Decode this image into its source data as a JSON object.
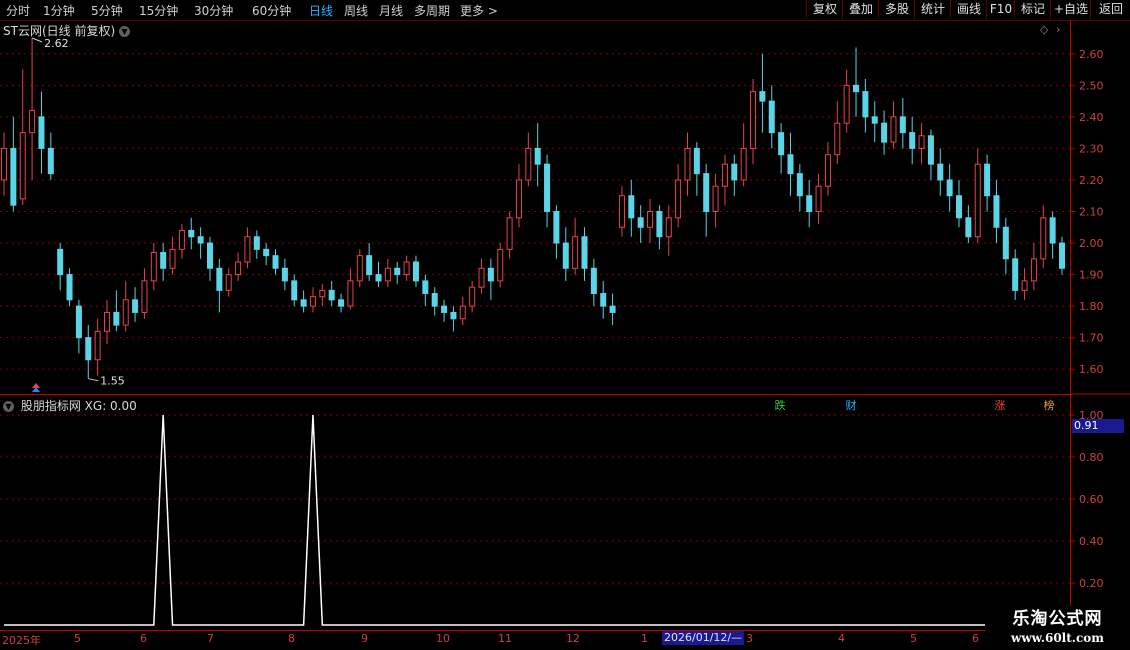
{
  "toolbar": {
    "periods": [
      "分时",
      "1分钟",
      "5分钟",
      "15分钟",
      "30分钟",
      "60分钟",
      "日线",
      "周线",
      "月线",
      "多周期",
      "更多 >"
    ],
    "active_period": "日线",
    "buttons": [
      "复权",
      "叠加",
      "多股",
      "统计",
      "画线",
      "F10",
      "标记",
      "+自选",
      "返回"
    ]
  },
  "main": {
    "title": "ST云网(日线 前复权)",
    "high_label": "2.62",
    "low_label": "1.55",
    "price_ticks": [
      "2.60",
      "2.50",
      "2.40",
      "2.30",
      "2.20",
      "2.10",
      "2.00",
      "1.90",
      "1.80",
      "1.70",
      "1.60"
    ],
    "badges": [
      {
        "text": "跌",
        "color": "#2ecc40"
      },
      {
        "text": "财",
        "color": "#2fb3ff"
      },
      {
        "text": "涨",
        "color": "#ff4040"
      },
      {
        "text": "榜",
        "color": "#e0a030"
      }
    ]
  },
  "indicator": {
    "title": "股朋指标网",
    "value_text": "XG: 0.00",
    "ticks": [
      "1.00",
      "0.80",
      "0.60",
      "0.40",
      "0.20"
    ],
    "cursor_value": "0.91"
  },
  "xaxis": {
    "months": [
      "2025年",
      "5",
      "6",
      "7",
      "8",
      "9",
      "10",
      "11",
      "12",
      "1",
      "2",
      "3",
      "4",
      "5",
      "6"
    ],
    "cursor_date": "2026/01/12/—"
  },
  "watermark": {
    "title": "乐淘公式网",
    "url": "www.60lt.com"
  },
  "colors": {
    "up": "#e8424c",
    "down": "#5ad4e6",
    "grid": "#8a0000",
    "signal": "#ffffff"
  },
  "chart_data": {
    "type": "candlestick",
    "ylim": [
      1.55,
      2.65
    ],
    "candles": [
      [
        2.2,
        2.3,
        2.15,
        2.35
      ],
      [
        2.3,
        2.12,
        2.1,
        2.4
      ],
      [
        2.14,
        2.35,
        2.12,
        2.55
      ],
      [
        2.35,
        2.42,
        2.2,
        2.65
      ],
      [
        2.4,
        2.3,
        2.22,
        2.48
      ],
      [
        2.3,
        2.22,
        2.2,
        2.35
      ],
      [
        1.98,
        1.9,
        1.85,
        2.0
      ],
      [
        1.9,
        1.82,
        1.8,
        1.92
      ],
      [
        1.8,
        1.7,
        1.65,
        1.82
      ],
      [
        1.7,
        1.63,
        1.57,
        1.74
      ],
      [
        1.63,
        1.72,
        1.58,
        1.76
      ],
      [
        1.72,
        1.78,
        1.68,
        1.82
      ],
      [
        1.78,
        1.74,
        1.72,
        1.85
      ],
      [
        1.74,
        1.82,
        1.72,
        1.88
      ],
      [
        1.82,
        1.78,
        1.75,
        1.86
      ],
      [
        1.78,
        1.88,
        1.76,
        1.92
      ],
      [
        1.88,
        1.97,
        1.85,
        2.0
      ],
      [
        1.97,
        1.92,
        1.88,
        2.0
      ],
      [
        1.92,
        1.98,
        1.9,
        2.02
      ],
      [
        1.98,
        2.04,
        1.95,
        2.06
      ],
      [
        2.04,
        2.02,
        1.98,
        2.08
      ],
      [
        2.02,
        2.0,
        1.95,
        2.05
      ],
      [
        2.0,
        1.92,
        1.88,
        2.02
      ],
      [
        1.92,
        1.85,
        1.78,
        1.95
      ],
      [
        1.85,
        1.9,
        1.83,
        1.92
      ],
      [
        1.9,
        1.94,
        1.88,
        1.97
      ],
      [
        1.94,
        2.02,
        1.92,
        2.05
      ],
      [
        2.02,
        1.98,
        1.95,
        2.04
      ],
      [
        1.98,
        1.96,
        1.93,
        2.0
      ],
      [
        1.96,
        1.92,
        1.9,
        1.98
      ],
      [
        1.92,
        1.88,
        1.85,
        1.95
      ],
      [
        1.88,
        1.82,
        1.8,
        1.9
      ],
      [
        1.82,
        1.8,
        1.78,
        1.85
      ],
      [
        1.8,
        1.83,
        1.78,
        1.86
      ],
      [
        1.83,
        1.85,
        1.8,
        1.87
      ],
      [
        1.85,
        1.82,
        1.8,
        1.88
      ],
      [
        1.82,
        1.8,
        1.78,
        1.84
      ],
      [
        1.8,
        1.88,
        1.79,
        1.92
      ],
      [
        1.88,
        1.96,
        1.86,
        1.98
      ],
      [
        1.96,
        1.9,
        1.88,
        2.0
      ],
      [
        1.9,
        1.88,
        1.86,
        1.94
      ],
      [
        1.88,
        1.92,
        1.86,
        1.95
      ],
      [
        1.92,
        1.9,
        1.87,
        1.94
      ],
      [
        1.9,
        1.94,
        1.88,
        1.96
      ],
      [
        1.94,
        1.88,
        1.86,
        1.96
      ],
      [
        1.88,
        1.84,
        1.8,
        1.9
      ],
      [
        1.84,
        1.8,
        1.77,
        1.86
      ],
      [
        1.8,
        1.78,
        1.75,
        1.82
      ],
      [
        1.78,
        1.76,
        1.72,
        1.8
      ],
      [
        1.76,
        1.8,
        1.74,
        1.83
      ],
      [
        1.8,
        1.86,
        1.78,
        1.88
      ],
      [
        1.86,
        1.92,
        1.84,
        1.95
      ],
      [
        1.92,
        1.88,
        1.82,
        1.95
      ],
      [
        1.88,
        1.98,
        1.86,
        2.0
      ],
      [
        1.98,
        2.08,
        1.95,
        2.1
      ],
      [
        2.08,
        2.2,
        2.05,
        2.25
      ],
      [
        2.2,
        2.3,
        2.18,
        2.35
      ],
      [
        2.3,
        2.25,
        2.18,
        2.38
      ],
      [
        2.25,
        2.1,
        2.05,
        2.28
      ],
      [
        2.1,
        2.0,
        1.95,
        2.12
      ],
      [
        2.0,
        1.92,
        1.88,
        2.05
      ],
      [
        1.92,
        2.02,
        1.9,
        2.08
      ],
      [
        2.02,
        1.92,
        1.88,
        2.05
      ],
      [
        1.92,
        1.84,
        1.8,
        1.95
      ],
      [
        1.84,
        1.8,
        1.76,
        1.88
      ],
      [
        1.8,
        1.78,
        1.74,
        1.84
      ],
      [
        2.05,
        2.15,
        2.02,
        2.18
      ],
      [
        2.15,
        2.08,
        2.02,
        2.2
      ],
      [
        2.08,
        2.05,
        2.0,
        2.12
      ],
      [
        2.05,
        2.1,
        2.0,
        2.14
      ],
      [
        2.1,
        2.02,
        1.98,
        2.12
      ],
      [
        2.02,
        2.08,
        1.96,
        2.12
      ],
      [
        2.08,
        2.2,
        2.05,
        2.25
      ],
      [
        2.2,
        2.3,
        2.15,
        2.35
      ],
      [
        2.3,
        2.22,
        2.15,
        2.32
      ],
      [
        2.22,
        2.1,
        2.02,
        2.25
      ],
      [
        2.1,
        2.18,
        2.05,
        2.22
      ],
      [
        2.18,
        2.25,
        2.12,
        2.28
      ],
      [
        2.25,
        2.2,
        2.15,
        2.28
      ],
      [
        2.2,
        2.3,
        2.18,
        2.38
      ],
      [
        2.3,
        2.48,
        2.25,
        2.52
      ],
      [
        2.48,
        2.45,
        2.35,
        2.6
      ],
      [
        2.45,
        2.35,
        2.3,
        2.5
      ],
      [
        2.35,
        2.28,
        2.22,
        2.38
      ],
      [
        2.28,
        2.22,
        2.15,
        2.35
      ],
      [
        2.22,
        2.15,
        2.1,
        2.25
      ],
      [
        2.15,
        2.1,
        2.05,
        2.2
      ],
      [
        2.1,
        2.18,
        2.06,
        2.22
      ],
      [
        2.18,
        2.28,
        2.15,
        2.32
      ],
      [
        2.28,
        2.38,
        2.25,
        2.45
      ],
      [
        2.38,
        2.5,
        2.35,
        2.55
      ],
      [
        2.5,
        2.48,
        2.4,
        2.62
      ],
      [
        2.48,
        2.4,
        2.35,
        2.52
      ],
      [
        2.4,
        2.38,
        2.32,
        2.45
      ],
      [
        2.38,
        2.32,
        2.28,
        2.42
      ],
      [
        2.32,
        2.4,
        2.3,
        2.45
      ],
      [
        2.4,
        2.35,
        2.3,
        2.46
      ],
      [
        2.35,
        2.3,
        2.25,
        2.4
      ],
      [
        2.3,
        2.34,
        2.25,
        2.38
      ],
      [
        2.34,
        2.25,
        2.2,
        2.36
      ],
      [
        2.25,
        2.2,
        2.15,
        2.3
      ],
      [
        2.2,
        2.15,
        2.1,
        2.25
      ],
      [
        2.15,
        2.08,
        2.05,
        2.2
      ],
      [
        2.08,
        2.02,
        2.0,
        2.12
      ],
      [
        2.02,
        2.25,
        2.0,
        2.3
      ],
      [
        2.25,
        2.15,
        2.1,
        2.28
      ],
      [
        2.15,
        2.05,
        2.0,
        2.2
      ],
      [
        2.05,
        1.95,
        1.9,
        2.08
      ],
      [
        1.95,
        1.85,
        1.82,
        1.98
      ],
      [
        1.85,
        1.88,
        1.82,
        1.92
      ],
      [
        1.88,
        1.95,
        1.85,
        2.0
      ],
      [
        1.95,
        2.08,
        1.92,
        2.12
      ],
      [
        2.08,
        2.0,
        1.95,
        2.1
      ],
      [
        2.0,
        1.92,
        1.9,
        2.02
      ]
    ],
    "indicator_series": {
      "name": "XG",
      "signal_positions_candle_index": [
        17,
        33
      ],
      "values": [
        0,
        0,
        0,
        0,
        0,
        0,
        0,
        0,
        0,
        0,
        0,
        0,
        0,
        0,
        0,
        0,
        0,
        1,
        0,
        0,
        0,
        0,
        0,
        0,
        0,
        0,
        0,
        0,
        0,
        0,
        0,
        0,
        0,
        1,
        0,
        0,
        0,
        0,
        0,
        0,
        0,
        0,
        0,
        0,
        0,
        0,
        0,
        0,
        0,
        0,
        0,
        0,
        0,
        0,
        0,
        0,
        0,
        0,
        0,
        0,
        0,
        0,
        0,
        0,
        0,
        0,
        0,
        0,
        0,
        0,
        0,
        0,
        0,
        0,
        0,
        0,
        0,
        0,
        0,
        0,
        0,
        0,
        0,
        0,
        0,
        0,
        0,
        0,
        0,
        0,
        0,
        0,
        0,
        0,
        0,
        0,
        0,
        0,
        0,
        0,
        0,
        0,
        0,
        0,
        0,
        0,
        0,
        0,
        0,
        0,
        0,
        0,
        0,
        0,
        0
      ]
    }
  }
}
